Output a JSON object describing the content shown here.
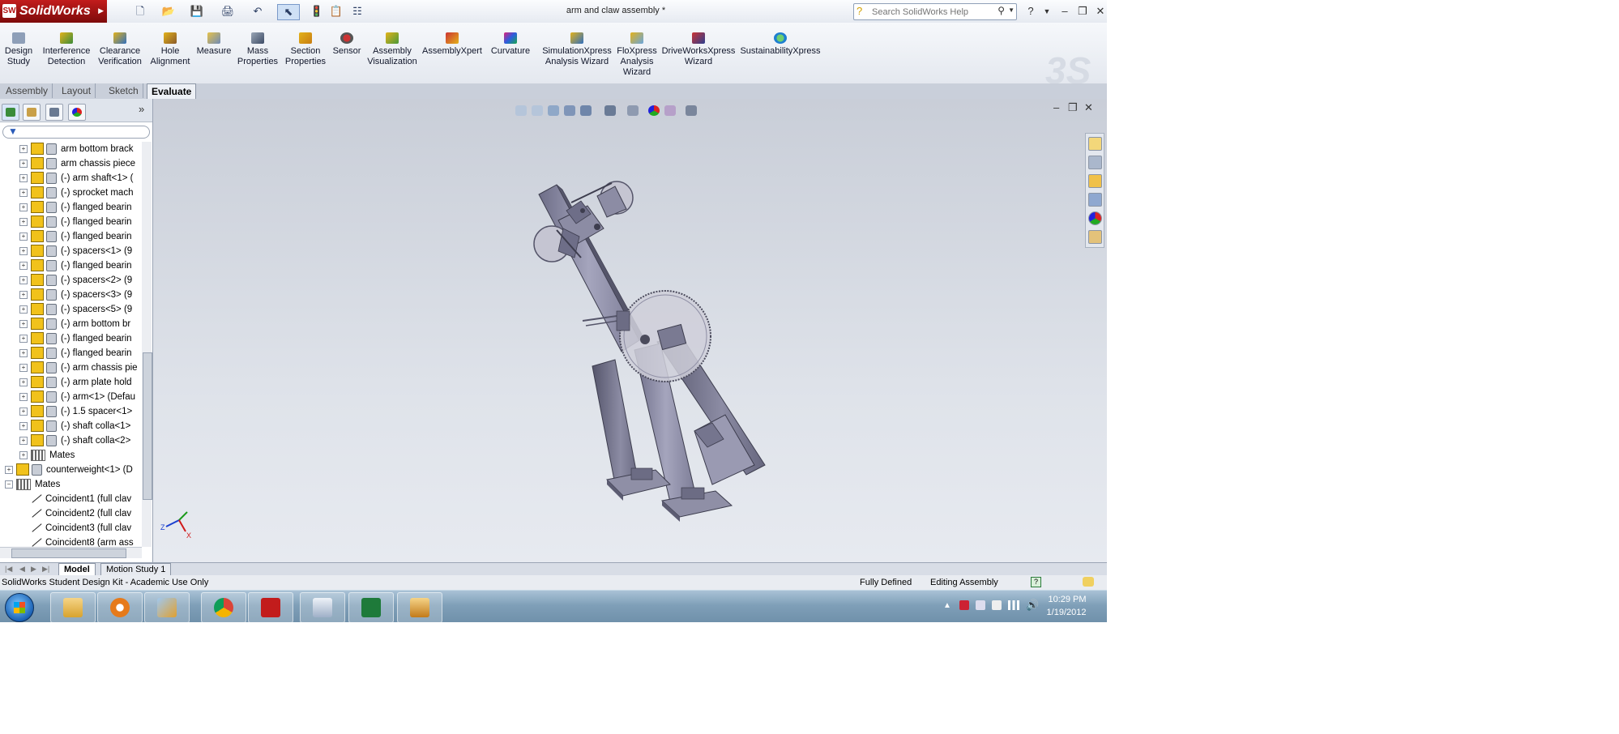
{
  "app": {
    "name": "SolidWorks",
    "document_title": "arm and claw assembly *"
  },
  "search": {
    "placeholder": "Search SolidWorks Help"
  },
  "toolbar": {
    "tools": [
      {
        "label": "Design Study"
      },
      {
        "label": "Interference Detection"
      },
      {
        "label": "Clearance Verification"
      },
      {
        "label": "Hole Alignment"
      },
      {
        "label": "Measure"
      },
      {
        "label": "Mass Properties"
      },
      {
        "label": "Section Properties"
      },
      {
        "label": "Sensor"
      },
      {
        "label": "Assembly Visualization"
      },
      {
        "label": "AssemblyXpert"
      },
      {
        "label": "Curvature"
      },
      {
        "label": "SimulationXpress Analysis Wizard"
      },
      {
        "label": "FloXpress Analysis Wizard"
      },
      {
        "label": "DriveWorksXpress Wizard"
      },
      {
        "label": "SustainabilityXpress"
      }
    ]
  },
  "command_tabs": [
    "Assembly",
    "Layout",
    "Sketch",
    "Evaluate"
  ],
  "active_command_tab": "Evaluate",
  "feature_tree": {
    "items": [
      {
        "text": "arm bottom brack",
        "kind": "part",
        "level": 1
      },
      {
        "text": "arm chassis piece",
        "kind": "part",
        "level": 1
      },
      {
        "text": "(-) arm shaft<1> (",
        "kind": "part",
        "level": 1
      },
      {
        "text": "(-) sprocket mach",
        "kind": "part",
        "level": 1
      },
      {
        "text": "(-) flanged bearin",
        "kind": "part",
        "level": 1
      },
      {
        "text": "(-) flanged bearin",
        "kind": "part",
        "level": 1
      },
      {
        "text": "(-) flanged bearin",
        "kind": "part",
        "level": 1
      },
      {
        "text": "(-) spacers<1> (9",
        "kind": "part",
        "level": 1
      },
      {
        "text": "(-) flanged bearin",
        "kind": "part",
        "level": 1
      },
      {
        "text": "(-) spacers<2> (9",
        "kind": "part",
        "level": 1
      },
      {
        "text": "(-) spacers<3> (9",
        "kind": "part",
        "level": 1
      },
      {
        "text": "(-) spacers<5> (9",
        "kind": "part",
        "level": 1
      },
      {
        "text": "(-) arm bottom br",
        "kind": "part",
        "level": 1
      },
      {
        "text": "(-) flanged bearin",
        "kind": "part",
        "level": 1
      },
      {
        "text": "(-) flanged bearin",
        "kind": "part",
        "level": 1
      },
      {
        "text": "(-) arm chassis pie",
        "kind": "part",
        "level": 1
      },
      {
        "text": "(-) arm plate hold",
        "kind": "part",
        "level": 1
      },
      {
        "text": "(-) arm<1> (Defau",
        "kind": "part",
        "level": 1
      },
      {
        "text": "(-) 1.5 spacer<1>",
        "kind": "part",
        "level": 1
      },
      {
        "text": "(-) shaft colla<1>",
        "kind": "part",
        "level": 1
      },
      {
        "text": "(-) shaft colla<2>",
        "kind": "part",
        "level": 1
      },
      {
        "text": "Mates",
        "kind": "mates",
        "level": 1
      },
      {
        "text": "counterweight<1> (D",
        "kind": "part",
        "level": 0
      },
      {
        "text": "Mates",
        "kind": "mates",
        "level": 0,
        "expanded": true
      },
      {
        "text": "Coincident1 (full clav",
        "kind": "mate",
        "level": 1
      },
      {
        "text": "Coincident2 (full clav",
        "kind": "mate",
        "level": 1
      },
      {
        "text": "Coincident3 (full clav",
        "kind": "mate",
        "level": 1
      },
      {
        "text": "Coincident8 (arm ass",
        "kind": "mate",
        "level": 1
      }
    ]
  },
  "bottom_tabs": [
    "Model",
    "Motion Study 1"
  ],
  "active_bottom_tab": "Model",
  "status_bar": {
    "left": "SolidWorks Student Design Kit - Academic Use Only",
    "state": "Fully Defined",
    "mode": "Editing Assembly"
  },
  "taskbar": {
    "apps": [
      "windows-explorer",
      "media-player",
      "paint",
      "chrome",
      "solidworks",
      "calculator",
      "excel",
      "file-manager"
    ],
    "time": "10:29 PM",
    "date": "1/19/2012"
  },
  "colors": {
    "brand_red": "#c21c1c",
    "viewport_top": "#c9ced8",
    "viewport_bottom": "#e7eaf0",
    "model_steel": "#8e8ea8"
  }
}
